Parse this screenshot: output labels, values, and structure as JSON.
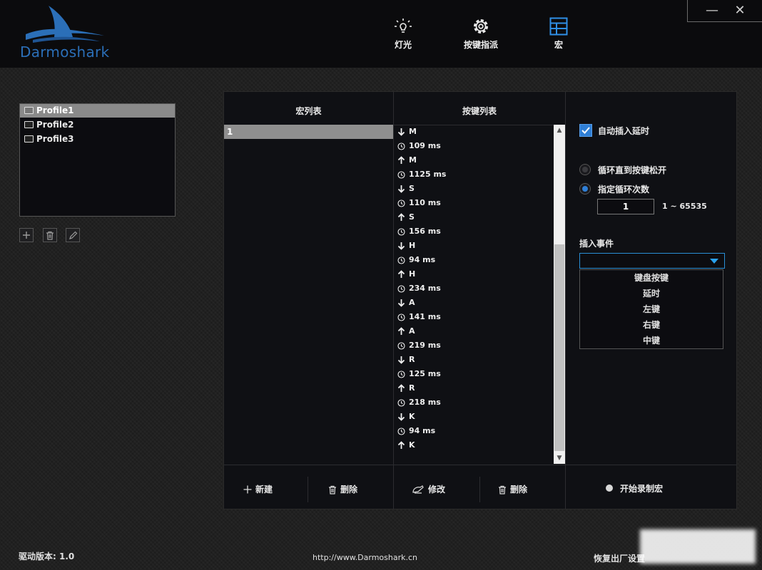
{
  "brand": {
    "name": "Darmoshark"
  },
  "colors": {
    "accent": "#2f7fd6",
    "dropdown_border": "#2a8fd6",
    "selected_row": "#8f8f8f"
  },
  "nav": [
    {
      "label": "灯光",
      "icon": "bulb-icon"
    },
    {
      "label": "按键指派",
      "icon": "gear-icon"
    },
    {
      "label": "宏",
      "icon": "grid-icon"
    }
  ],
  "window": {
    "minimize": "—",
    "close": "✕"
  },
  "profiles": [
    "Profile1",
    "Profile2",
    "Profile3"
  ],
  "selected_profile": "Profile1",
  "macro_panel": {
    "header": "宏列表",
    "macros": [
      "1"
    ],
    "new_label": "新建",
    "delete_label": "删除"
  },
  "key_panel": {
    "header": "按键列表",
    "events": [
      {
        "type": "down",
        "text": "M"
      },
      {
        "type": "delay",
        "text": "109 ms"
      },
      {
        "type": "up",
        "text": "M"
      },
      {
        "type": "delay",
        "text": "1125 ms"
      },
      {
        "type": "down",
        "text": "S"
      },
      {
        "type": "delay",
        "text": "110 ms"
      },
      {
        "type": "up",
        "text": "S"
      },
      {
        "type": "delay",
        "text": "156 ms"
      },
      {
        "type": "down",
        "text": "H"
      },
      {
        "type": "delay",
        "text": "94 ms"
      },
      {
        "type": "up",
        "text": "H"
      },
      {
        "type": "delay",
        "text": "234 ms"
      },
      {
        "type": "down",
        "text": "A"
      },
      {
        "type": "delay",
        "text": "141 ms"
      },
      {
        "type": "up",
        "text": "A"
      },
      {
        "type": "delay",
        "text": "219 ms"
      },
      {
        "type": "down",
        "text": "R"
      },
      {
        "type": "delay",
        "text": "125 ms"
      },
      {
        "type": "up",
        "text": "R"
      },
      {
        "type": "delay",
        "text": "218 ms"
      },
      {
        "type": "down",
        "text": "K"
      },
      {
        "type": "delay",
        "text": "94 ms"
      },
      {
        "type": "up",
        "text": "K"
      }
    ],
    "modify_label": "修改",
    "delete_label": "删除"
  },
  "options": {
    "auto_delay_label": "自动插入延时",
    "auto_delay_checked": true,
    "loop_until_release_label": "循环直到按键松开",
    "loop_count_label": "指定循环次数",
    "loop_mode": "count",
    "loop_count": "1",
    "loop_range": "1 ~ 65535",
    "insert_event_label": "插入事件",
    "insert_event_value": "",
    "insert_event_options": [
      "键盘按键",
      "延时",
      "左键",
      "右键",
      "中键"
    ],
    "record_label": "开始录制宏"
  },
  "footer": {
    "version": "驱动版本: 1.0",
    "url": "http://www.Darmoshark.cn",
    "reset": "恢复出厂设置"
  }
}
